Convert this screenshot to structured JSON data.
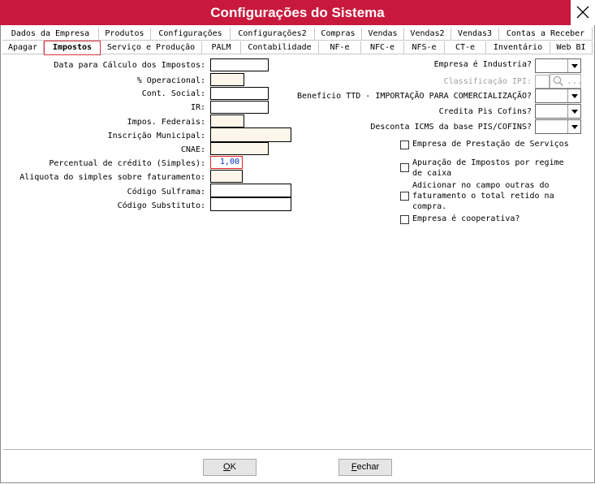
{
  "window": {
    "title": "Configurações do Sistema"
  },
  "tabs_row1": [
    "Dados da Empresa",
    "Produtos",
    "Configurações",
    "Configurações2",
    "Compras",
    "Vendas",
    "Vendas2",
    "Vendas3",
    "Contas a Receber"
  ],
  "tabs_row2": [
    "Apagar",
    "Impostos",
    "Serviço e Produção",
    "PALM",
    "Contabilidade",
    "NF-e",
    "NFC-e",
    "NFS-e",
    "CT-e",
    "Inventário",
    "Web BI"
  ],
  "active_tab": "Impostos",
  "left_fields": {
    "data_calculo": {
      "label": "Data para Cálculo dos Impostos:",
      "value": ""
    },
    "pct_operacional": {
      "label": "% Operacional:",
      "value": ""
    },
    "cont_social": {
      "label": "Cont. Social:",
      "value": ""
    },
    "ir": {
      "label": "IR:",
      "value": ""
    },
    "impos_federais": {
      "label": "Impos. Federais:",
      "value": ""
    },
    "inscricao_municipal": {
      "label": "Inscrição Municipal:",
      "value": ""
    },
    "cnae": {
      "label": "CNAE:",
      "value": ""
    },
    "percentual_credito": {
      "label": "Percentual de crédito (Simples):",
      "value": "1,00"
    },
    "aliquota_simples": {
      "label": "Aliquota do simples sobre faturamento:",
      "value": ""
    },
    "codigo_sulframa": {
      "label": "Código Sulframa:",
      "value": ""
    },
    "codigo_substituto": {
      "label": "Código Substituto:",
      "value": ""
    }
  },
  "right_fields": {
    "empresa_industria": {
      "label": "Empresa é Industria?",
      "value": ""
    },
    "classificacao_ipi": {
      "label": "Classificação IPI:",
      "value": "",
      "search_dots": "..."
    },
    "beneficio_ttd": {
      "label": "Benefício TTD - IMPORTAÇÃO PARA COMERCIALIZAÇÃO?",
      "value": ""
    },
    "credita_pis": {
      "label": "Credita Pis Cofins?",
      "value": ""
    },
    "desconta_icms": {
      "label": "Desconta ICMS da base PIS/COFINS?",
      "value": ""
    }
  },
  "checkboxes": {
    "prestacao_servicos": "Empresa de Prestação de Serviços",
    "apuracao_caixa": [
      "Apuração de Impostos por regime",
      "de caixa"
    ],
    "adicionar_outras": [
      "Adicionar no campo outras do",
      "faturamento o total retido na",
      "compra."
    ],
    "cooperativa": "Empresa é cooperativa?"
  },
  "buttons": {
    "ok_accel": "O",
    "ok_rest": "K",
    "fechar_accel": "F",
    "fechar_rest": "echar"
  }
}
